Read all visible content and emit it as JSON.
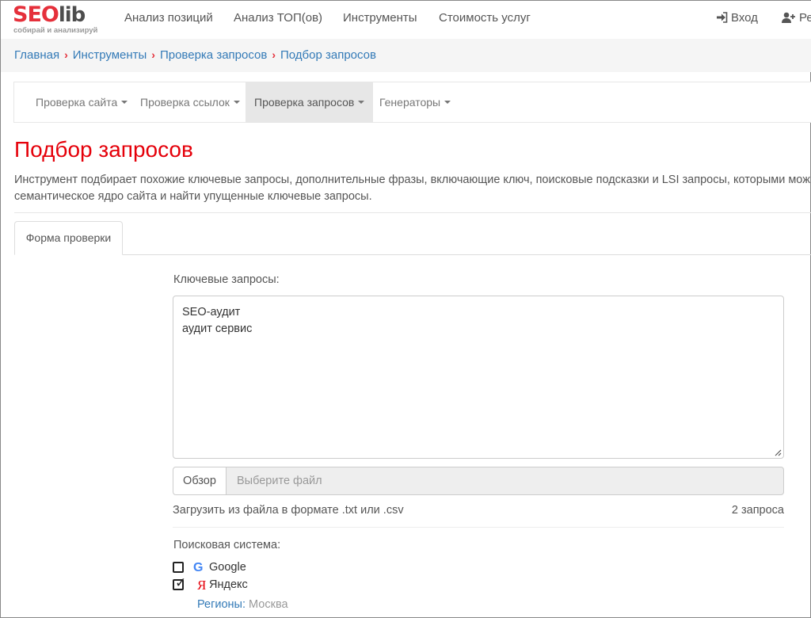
{
  "logo": {
    "part1": "SEO",
    "part2": "lib",
    "tagline": "собирай и анализируй"
  },
  "nav": {
    "items": [
      "Анализ позиций",
      "Анализ ТОП(ов)",
      "Инструменты",
      "Стоимость услуг"
    ],
    "login": "Вход",
    "register": "Ре"
  },
  "breadcrumb": [
    "Главная",
    "Инструменты",
    "Проверка запросов",
    "Подбор запросов"
  ],
  "subnav": {
    "items": [
      "Проверка сайта",
      "Проверка ссылок",
      "Проверка запросов",
      "Генераторы"
    ],
    "active_index": 2
  },
  "page": {
    "title": "Подбор запросов",
    "description": "Инструмент подбирает похожие ключевые запросы, дополнительные фразы, включающие ключ, поисковые подсказки и LSI запросы, которыми мож семантическое ядро сайта и найти упущенные ключевые запросы."
  },
  "tabs": [
    "Форма проверки"
  ],
  "form": {
    "keywords_label": "Ключевые запросы:",
    "keywords_value": "SEO-аудит\nаудит сервис",
    "browse_label": "Обзор",
    "file_placeholder": "Выберите файл",
    "upload_hint": "Загрузить из файла в формате .txt или .csv",
    "count_text": "2 запроса",
    "engine_label": "Поисковая система:",
    "engines": [
      {
        "icon": "G",
        "name": "Google",
        "checked": false,
        "color": "#4285f4"
      },
      {
        "icon": "Я",
        "name": "Яндекс",
        "checked": true,
        "color": "#e5000a"
      }
    ],
    "regions_label": "Регионы:",
    "regions_value": "Москва"
  },
  "colors": {
    "brand_red": "#e5303b",
    "title_red": "#e5000a",
    "link_blue": "#337ab7"
  }
}
